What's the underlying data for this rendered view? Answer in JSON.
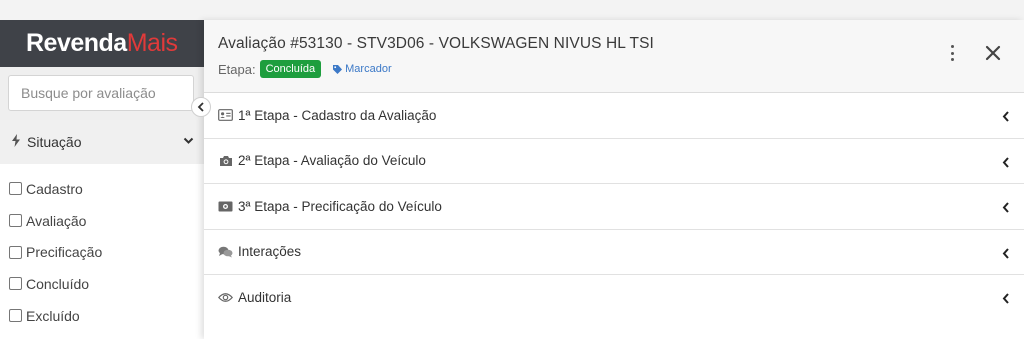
{
  "brand": {
    "logo_main": "Revenda",
    "logo_accent": "Mais"
  },
  "sidebar": {
    "search_placeholder": "Busque por avaliação",
    "section_title": "Situação",
    "filters": [
      {
        "label": "Cadastro"
      },
      {
        "label": "Avaliação"
      },
      {
        "label": "Precificação"
      },
      {
        "label": "Concluído"
      },
      {
        "label": "Excluído"
      }
    ]
  },
  "panel": {
    "title": "Avaliação #53130 - STV3D06 - VOLKSWAGEN NIVUS HL TSI",
    "etapa_label": "Etapa:",
    "status_badge": "Concluída",
    "marker_label": "Marcador",
    "colors": {
      "badge": "#1e9e3e",
      "marker": "#3c79c7",
      "logo_accent": "#e03a3a"
    },
    "sections": [
      {
        "label": "1ª Etapa - Cadastro da Avaliação",
        "icon": "id-card-icon"
      },
      {
        "label": "2ª Etapa - Avaliação do Veículo",
        "icon": "camera-icon"
      },
      {
        "label": "3ª Etapa - Precificação do Veículo",
        "icon": "money-bill-icon"
      },
      {
        "label": "Interações",
        "icon": "comments-icon"
      },
      {
        "label": "Auditoria",
        "icon": "eye-icon"
      }
    ]
  }
}
